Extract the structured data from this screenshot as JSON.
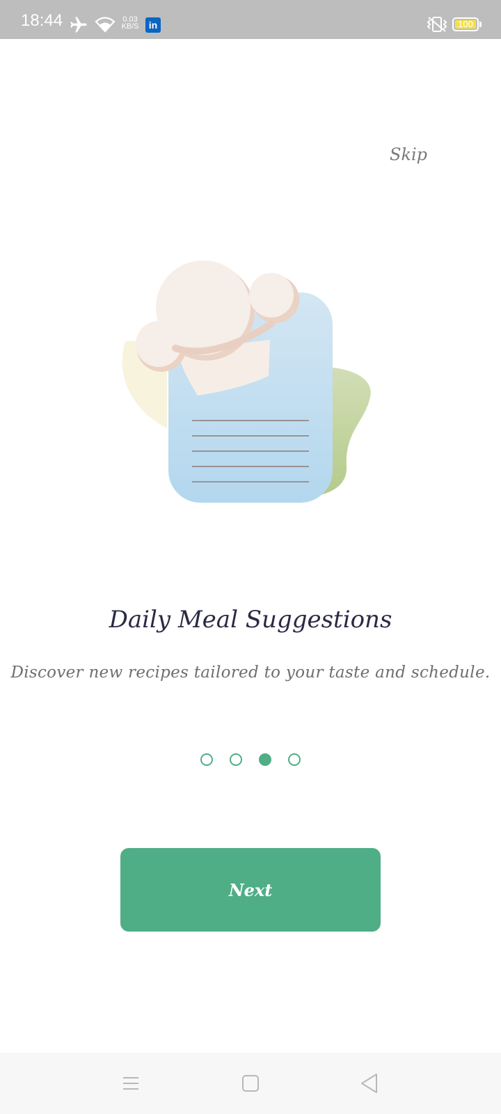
{
  "status_bar": {
    "time": "18:44",
    "net_speed_value": "0.03",
    "net_speed_unit": "KB/S",
    "linkedin_label": "in",
    "battery": "100",
    "icons": [
      "airplane-icon",
      "wifi-icon",
      "linkedin-icon",
      "vibrate-icon",
      "battery-icon"
    ]
  },
  "onboarding": {
    "skip_label": "Skip",
    "title": "Daily Meal Suggestions",
    "description": "Discover new recipes tailored to your taste and schedule.",
    "page_count": 4,
    "current_page": 3,
    "next_label": "Next"
  },
  "nav_bar": {
    "icons": [
      "menu-icon",
      "home-square-icon",
      "back-triangle-icon"
    ]
  },
  "colors": {
    "accent": "#4fae86",
    "title": "#2b2a44",
    "text_muted": "#6e6e6e",
    "status_bar_bg": "#bdbdbd",
    "battery_fill": "#f5e04a",
    "linkedin": "#0a66c2"
  }
}
